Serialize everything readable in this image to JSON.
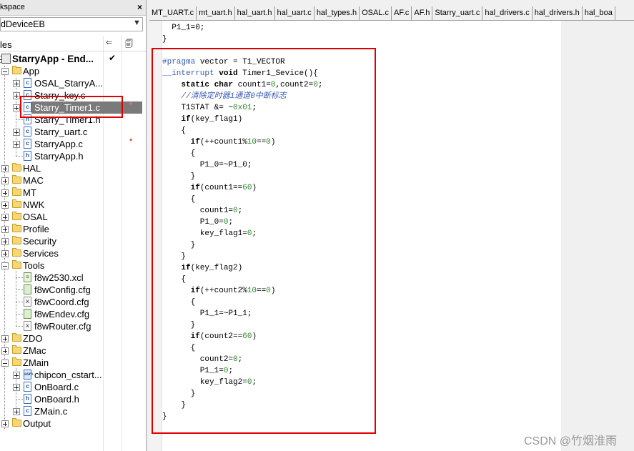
{
  "workspace": {
    "title": "kspace",
    "close": "×",
    "config": "dDeviceEB",
    "config_arrow": "▼",
    "files_label": "les",
    "col_icon1": "⇐",
    "col_icon2": "🗐",
    "root": "StarryApp - End...",
    "root_check": "✔",
    "items": [
      {
        "label": "App"
      },
      {
        "label": "OSAL_StarryA..."
      },
      {
        "label": "Starry_key.c"
      },
      {
        "label": "Starry_Timer1.c"
      },
      {
        "label": "Starry_Timer1.h"
      },
      {
        "label": "Starry_uart.c"
      },
      {
        "label": "StarryApp.c"
      },
      {
        "label": "StarryApp.h"
      },
      {
        "label": "HAL"
      },
      {
        "label": "MAC"
      },
      {
        "label": "MT"
      },
      {
        "label": "NWK"
      },
      {
        "label": "OSAL"
      },
      {
        "label": "Profile"
      },
      {
        "label": "Security"
      },
      {
        "label": "Services"
      },
      {
        "label": "Tools"
      },
      {
        "label": "f8w2530.xcl"
      },
      {
        "label": "f8wConfig.cfg"
      },
      {
        "label": "f8wCoord.cfg"
      },
      {
        "label": "f8wEndev.cfg"
      },
      {
        "label": "f8wRouter.cfg"
      },
      {
        "label": "ZDO"
      },
      {
        "label": "ZMac"
      },
      {
        "label": "ZMain"
      },
      {
        "label": "chipcon_cstart..."
      },
      {
        "label": "OnBoard.c"
      },
      {
        "label": "OnBoard.h"
      },
      {
        "label": "ZMain.c"
      },
      {
        "label": "Output"
      }
    ],
    "modified_marker": "*"
  },
  "tabs": [
    "MT_UART.c",
    "mt_uart.h",
    "hal_uart.h",
    "hal_uart.c",
    "hal_types.h",
    "OSAL.c",
    "AF.c",
    "AF.h",
    "Starry_uart.c",
    "hal_drivers.c",
    "hal_drivers.h",
    "hal_boa"
  ],
  "code_lines": [
    {
      "segs": [
        {
          "t": "  P1_1=0;",
          "c": ""
        }
      ]
    },
    {
      "segs": [
        {
          "t": "}",
          "c": ""
        }
      ]
    },
    {
      "segs": [
        {
          "t": "",
          "c": ""
        }
      ]
    },
    {
      "segs": [
        {
          "t": "#pragma",
          "c": "pp"
        },
        {
          "t": " vector = T1_VECTOR",
          "c": ""
        }
      ]
    },
    {
      "segs": [
        {
          "t": "__interrupt",
          "c": "pp"
        },
        {
          "t": " ",
          "c": ""
        },
        {
          "t": "void",
          "c": "kw"
        },
        {
          "t": " Timer1_Sevice(){",
          "c": ""
        }
      ]
    },
    {
      "segs": [
        {
          "t": "    ",
          "c": ""
        },
        {
          "t": "static char",
          "c": "kw"
        },
        {
          "t": " count1=",
          "c": ""
        },
        {
          "t": "0",
          "c": "num"
        },
        {
          "t": ",count2=",
          "c": ""
        },
        {
          "t": "0",
          "c": "num"
        },
        {
          "t": ";",
          "c": ""
        }
      ]
    },
    {
      "segs": [
        {
          "t": "    ",
          "c": ""
        },
        {
          "t": "//清除定时器1通道0中断标志",
          "c": "cm"
        }
      ]
    },
    {
      "segs": [
        {
          "t": "    T1STAT &= ~",
          "c": ""
        },
        {
          "t": "0x01",
          "c": "num"
        },
        {
          "t": ";",
          "c": ""
        }
      ]
    },
    {
      "segs": [
        {
          "t": "    ",
          "c": ""
        },
        {
          "t": "if",
          "c": "kw"
        },
        {
          "t": "(key_flag1)",
          "c": ""
        }
      ]
    },
    {
      "segs": [
        {
          "t": "    {",
          "c": ""
        }
      ]
    },
    {
      "segs": [
        {
          "t": "      ",
          "c": ""
        },
        {
          "t": "if",
          "c": "kw"
        },
        {
          "t": "(++count1%",
          "c": ""
        },
        {
          "t": "10",
          "c": "num"
        },
        {
          "t": "==",
          "c": ""
        },
        {
          "t": "0",
          "c": "num"
        },
        {
          "t": ")",
          "c": ""
        }
      ]
    },
    {
      "segs": [
        {
          "t": "      {",
          "c": ""
        }
      ]
    },
    {
      "segs": [
        {
          "t": "        P1_0=~P1_0;",
          "c": ""
        }
      ]
    },
    {
      "segs": [
        {
          "t": "      }",
          "c": ""
        }
      ]
    },
    {
      "segs": [
        {
          "t": "      ",
          "c": ""
        },
        {
          "t": "if",
          "c": "kw"
        },
        {
          "t": "(count1==",
          "c": ""
        },
        {
          "t": "60",
          "c": "num"
        },
        {
          "t": ")",
          "c": ""
        }
      ]
    },
    {
      "segs": [
        {
          "t": "      {",
          "c": ""
        }
      ]
    },
    {
      "segs": [
        {
          "t": "        count1=",
          "c": ""
        },
        {
          "t": "0",
          "c": "num"
        },
        {
          "t": ";",
          "c": ""
        }
      ]
    },
    {
      "segs": [
        {
          "t": "        P1_0=",
          "c": ""
        },
        {
          "t": "0",
          "c": "num"
        },
        {
          "t": ";",
          "c": ""
        }
      ]
    },
    {
      "segs": [
        {
          "t": "        key_flag1=",
          "c": ""
        },
        {
          "t": "0",
          "c": "num"
        },
        {
          "t": ";",
          "c": ""
        }
      ]
    },
    {
      "segs": [
        {
          "t": "      }",
          "c": ""
        }
      ]
    },
    {
      "segs": [
        {
          "t": "    }",
          "c": ""
        }
      ]
    },
    {
      "segs": [
        {
          "t": "    ",
          "c": ""
        },
        {
          "t": "if",
          "c": "kw"
        },
        {
          "t": "(key_flag2)",
          "c": ""
        }
      ]
    },
    {
      "segs": [
        {
          "t": "    {",
          "c": ""
        }
      ]
    },
    {
      "segs": [
        {
          "t": "      ",
          "c": ""
        },
        {
          "t": "if",
          "c": "kw"
        },
        {
          "t": "(++count2%",
          "c": ""
        },
        {
          "t": "10",
          "c": "num"
        },
        {
          "t": "==",
          "c": ""
        },
        {
          "t": "0",
          "c": "num"
        },
        {
          "t": ")",
          "c": ""
        }
      ]
    },
    {
      "segs": [
        {
          "t": "      {",
          "c": ""
        }
      ]
    },
    {
      "segs": [
        {
          "t": "        P1_1=~P1_1;",
          "c": ""
        }
      ]
    },
    {
      "segs": [
        {
          "t": "      }",
          "c": ""
        }
      ]
    },
    {
      "segs": [
        {
          "t": "      ",
          "c": ""
        },
        {
          "t": "if",
          "c": "kw"
        },
        {
          "t": "(count2==",
          "c": ""
        },
        {
          "t": "60",
          "c": "num"
        },
        {
          "t": ")",
          "c": ""
        }
      ]
    },
    {
      "segs": [
        {
          "t": "      {",
          "c": ""
        }
      ]
    },
    {
      "segs": [
        {
          "t": "        count2=",
          "c": ""
        },
        {
          "t": "0",
          "c": "num"
        },
        {
          "t": ";",
          "c": ""
        }
      ]
    },
    {
      "segs": [
        {
          "t": "        P1_1=",
          "c": ""
        },
        {
          "t": "0",
          "c": "num"
        },
        {
          "t": ";",
          "c": ""
        }
      ]
    },
    {
      "segs": [
        {
          "t": "        key_flag2=",
          "c": ""
        },
        {
          "t": "0",
          "c": "num"
        },
        {
          "t": ";",
          "c": ""
        }
      ]
    },
    {
      "segs": [
        {
          "t": "      }",
          "c": ""
        }
      ]
    },
    {
      "segs": [
        {
          "t": "    }",
          "c": ""
        }
      ]
    },
    {
      "segs": [
        {
          "t": "}",
          "c": ""
        }
      ]
    }
  ],
  "watermark": "CSDN @竹烟淮雨",
  "colors": {
    "highlight_box": "#e00000",
    "selection": "#7a7a7a",
    "keyword_blue": "#3a5ab8",
    "number_green": "#2a8a2a"
  }
}
